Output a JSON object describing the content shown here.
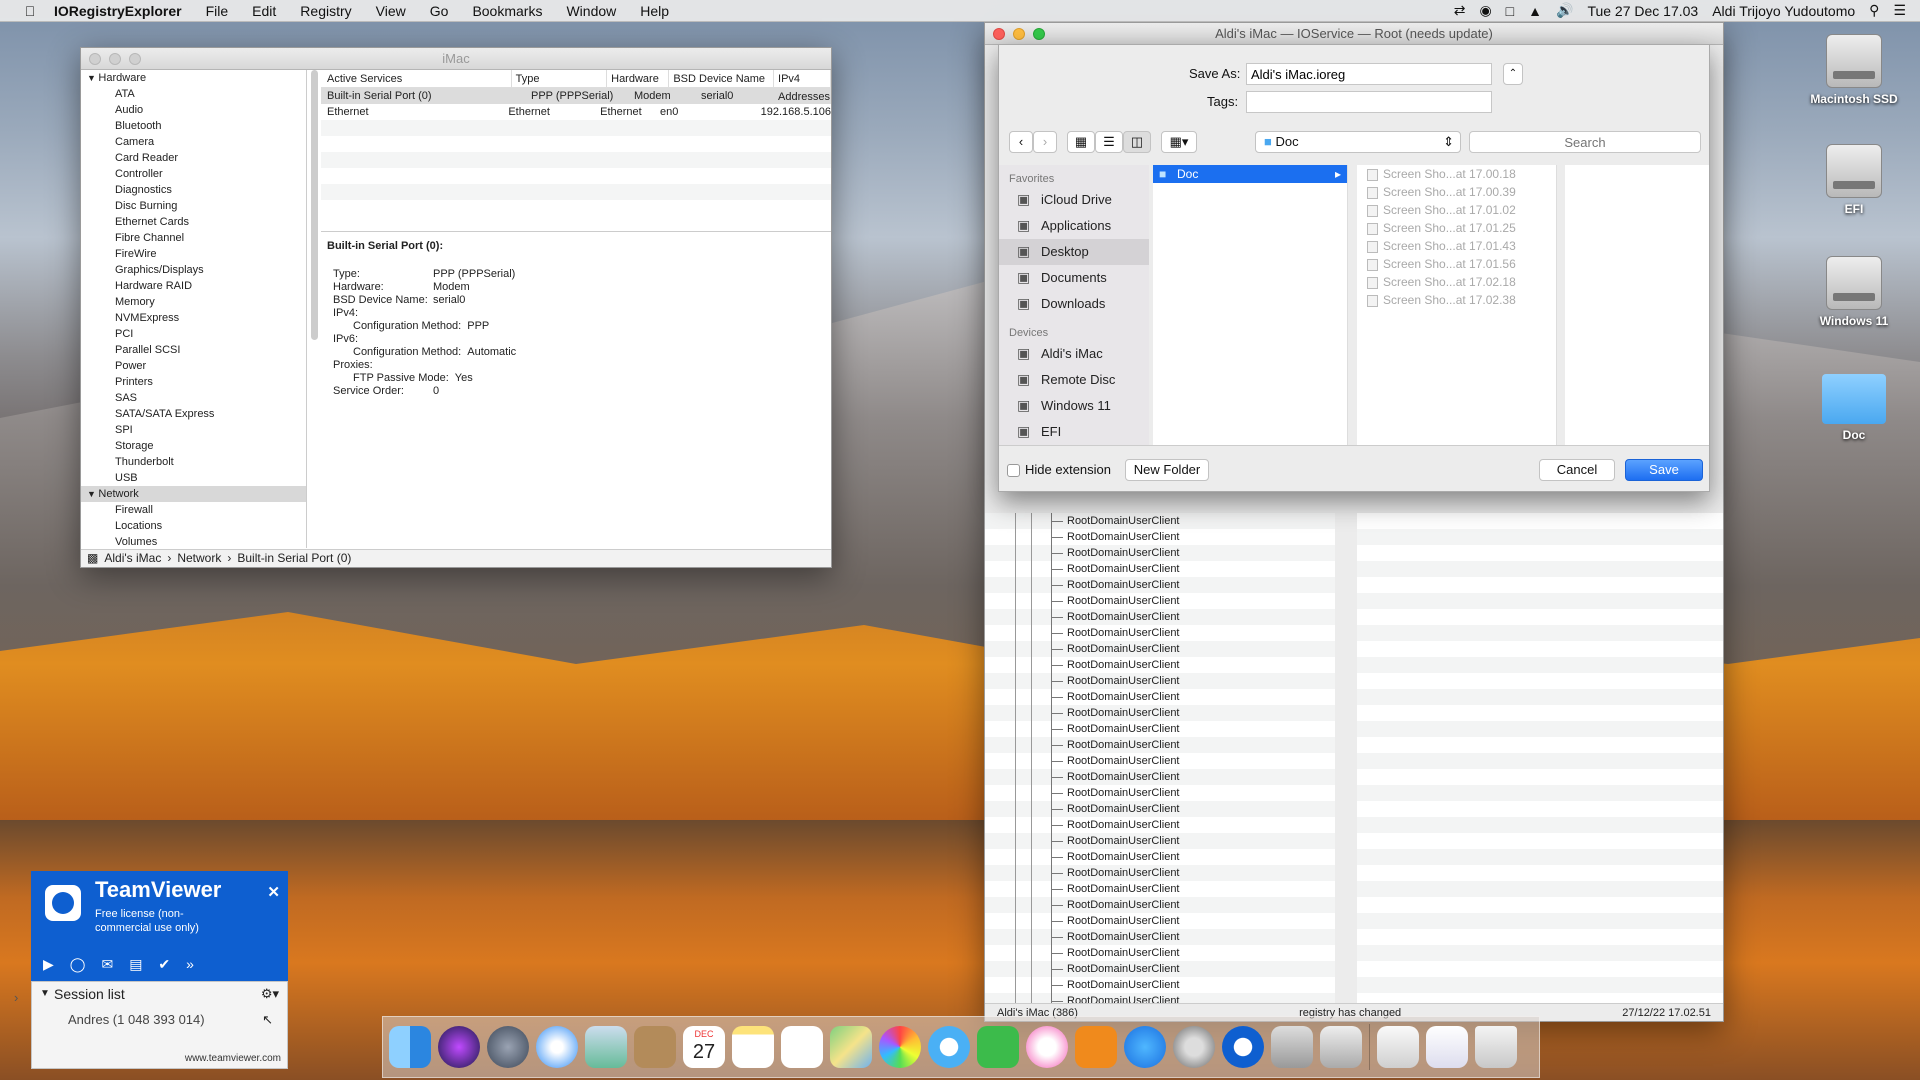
{
  "menubar": {
    "app": "IORegistryExplorer",
    "items": [
      "File",
      "Edit",
      "Registry",
      "View",
      "Go",
      "Bookmarks",
      "Window",
      "Help"
    ],
    "clock": "Tue 27 Dec  17.03",
    "user": "Aldi Trijoyo Yudoutomo"
  },
  "sysinfo": {
    "title": "iMac",
    "sidebar": [
      {
        "type": "cat",
        "label": "Hardware"
      },
      {
        "type": "item",
        "label": "ATA"
      },
      {
        "type": "item",
        "label": "Audio"
      },
      {
        "type": "item",
        "label": "Bluetooth"
      },
      {
        "type": "item",
        "label": "Camera"
      },
      {
        "type": "item",
        "label": "Card Reader"
      },
      {
        "type": "item",
        "label": "Controller"
      },
      {
        "type": "item",
        "label": "Diagnostics"
      },
      {
        "type": "item",
        "label": "Disc Burning"
      },
      {
        "type": "item",
        "label": "Ethernet Cards"
      },
      {
        "type": "item",
        "label": "Fibre Channel"
      },
      {
        "type": "item",
        "label": "FireWire"
      },
      {
        "type": "item",
        "label": "Graphics/Displays"
      },
      {
        "type": "item",
        "label": "Hardware RAID"
      },
      {
        "type": "item",
        "label": "Memory"
      },
      {
        "type": "item",
        "label": "NVMExpress"
      },
      {
        "type": "item",
        "label": "PCI"
      },
      {
        "type": "item",
        "label": "Parallel SCSI"
      },
      {
        "type": "item",
        "label": "Power"
      },
      {
        "type": "item",
        "label": "Printers"
      },
      {
        "type": "item",
        "label": "SAS"
      },
      {
        "type": "item",
        "label": "SATA/SATA Express"
      },
      {
        "type": "item",
        "label": "SPI"
      },
      {
        "type": "item",
        "label": "Storage"
      },
      {
        "type": "item",
        "label": "Thunderbolt"
      },
      {
        "type": "item",
        "label": "USB"
      },
      {
        "type": "cat",
        "label": "Network",
        "selected": true
      },
      {
        "type": "item",
        "label": "Firewall"
      },
      {
        "type": "item",
        "label": "Locations"
      },
      {
        "type": "item",
        "label": "Volumes"
      }
    ],
    "headers": [
      "Active Services",
      "Type",
      "Hardware",
      "BSD Device Name",
      "IPv4 Addresses"
    ],
    "rows": [
      [
        "Built-in Serial Port (0)",
        "PPP (PPPSerial)",
        "Modem",
        "serial0",
        ""
      ],
      [
        "Ethernet",
        "Ethernet",
        "Ethernet",
        "en0",
        "192.168.5.106"
      ]
    ],
    "detail_title": "Built-in Serial Port (0):",
    "detail": [
      {
        "k": "Type:",
        "v": "PPP (PPPSerial)",
        "lvl": 0
      },
      {
        "k": "Hardware:",
        "v": "Modem",
        "lvl": 0
      },
      {
        "k": "BSD Device Name:",
        "v": "serial0",
        "lvl": 0
      },
      {
        "k": "IPv4:",
        "v": "",
        "lvl": 0
      },
      {
        "k": "Configuration Method:",
        "v": "PPP",
        "lvl": 1
      },
      {
        "k": "IPv6:",
        "v": "",
        "lvl": 0
      },
      {
        "k": "Configuration Method:",
        "v": "Automatic",
        "lvl": 1
      },
      {
        "k": "Proxies:",
        "v": "",
        "lvl": 0
      },
      {
        "k": "FTP Passive Mode:",
        "v": "Yes",
        "lvl": 1
      },
      {
        "k": "Service Order:",
        "v": "0",
        "lvl": 0
      }
    ],
    "path": [
      "Aldi's iMac",
      "Network",
      "Built-in Serial Port (0)"
    ]
  },
  "ioreg": {
    "title": "Aldi's iMac — IOService — Root (needs update)",
    "node_label": "RootDomainUserClient",
    "node_count": 32,
    "status_left": "Aldi's iMac (386)",
    "status_mid": "registry has changed",
    "status_right": "27/12/22 17.02.51"
  },
  "save": {
    "save_as_label": "Save As:",
    "save_as_value": "Aldi's iMac.ioreg",
    "tags_label": "Tags:",
    "location": "Doc",
    "search_placeholder": "Search",
    "favorites_label": "Favorites",
    "favorites": [
      {
        "label": "iCloud Drive",
        "icon": "cloud-icon"
      },
      {
        "label": "Applications",
        "icon": "applications-icon"
      },
      {
        "label": "Desktop",
        "icon": "desktop-icon",
        "selected": true
      },
      {
        "label": "Documents",
        "icon": "documents-icon"
      },
      {
        "label": "Downloads",
        "icon": "downloads-icon"
      }
    ],
    "devices_label": "Devices",
    "devices": [
      {
        "label": "Aldi's iMac",
        "icon": "imac-icon"
      },
      {
        "label": "Remote Disc",
        "icon": "disc-icon"
      },
      {
        "label": "Windows 11",
        "icon": "disk-icon"
      },
      {
        "label": "EFI",
        "icon": "disk-icon"
      }
    ],
    "folder": "Doc",
    "files": [
      "Screen Sho...at 17.00.18",
      "Screen Sho...at 17.00.39",
      "Screen Sho...at 17.01.02",
      "Screen Sho...at 17.01.25",
      "Screen Sho...at 17.01.43",
      "Screen Sho...at 17.01.56",
      "Screen Sho...at 17.02.18",
      "Screen Sho...at 17.02.38"
    ],
    "hide_ext": "Hide extension",
    "new_folder": "New Folder",
    "cancel": "Cancel",
    "save": "Save"
  },
  "desktop": [
    "Macintosh SSD",
    "EFI",
    "Windows 11",
    "Doc"
  ],
  "teamviewer": {
    "name": "TeamViewer",
    "license": "Free license (non-commercial use only)",
    "session_list": "Session list",
    "contact": "Andres (1 048 393 014)",
    "url": "www.teamviewer.com"
  },
  "dock": {
    "calendar_month": "DEC",
    "calendar_day": "27"
  },
  "colors": {
    "accent": "#1b6ff0",
    "teamviewer": "#0e5fd0"
  }
}
